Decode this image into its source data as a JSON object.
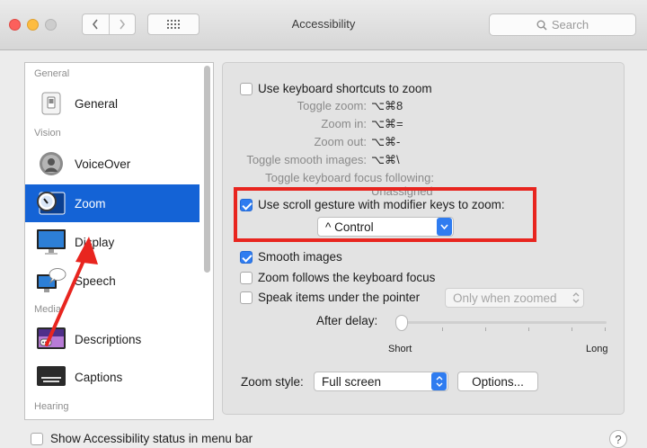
{
  "window": {
    "title": "Accessibility",
    "search_placeholder": "Search"
  },
  "sidebar": {
    "sections": [
      "General",
      "Vision",
      "Media",
      "Hearing"
    ],
    "items": [
      {
        "label": "General",
        "icon": "general-switch-icon"
      },
      {
        "label": "VoiceOver",
        "icon": "voiceover-icon"
      },
      {
        "label": "Zoom",
        "icon": "zoom-icon",
        "selected": true
      },
      {
        "label": "Display",
        "icon": "display-monitor-icon"
      },
      {
        "label": "Speech",
        "icon": "speech-bubble-icon"
      },
      {
        "label": "Descriptions",
        "icon": "descriptions-icon"
      },
      {
        "label": "Captions",
        "icon": "captions-icon"
      }
    ]
  },
  "zoom": {
    "keyboard_shortcuts_label": "Use keyboard shortcuts to zoom",
    "keyboard_shortcuts_checked": false,
    "shortcuts": [
      {
        "label": "Toggle zoom:",
        "value": "⌥⌘8"
      },
      {
        "label": "Zoom in:",
        "value": "⌥⌘="
      },
      {
        "label": "Zoom out:",
        "value": "⌥⌘-"
      },
      {
        "label": "Toggle smooth images:",
        "value": "⌥⌘\\"
      },
      {
        "label": "Toggle keyboard focus following:",
        "value": "Unassigned"
      }
    ],
    "scroll_gesture_label": "Use scroll gesture with modifier keys to zoom:",
    "scroll_gesture_checked": true,
    "modifier_key": "^ Control",
    "smooth_images_label": "Smooth images",
    "smooth_images_checked": true,
    "follow_focus_label": "Zoom follows the keyboard focus",
    "follow_focus_checked": false,
    "speak_items_label": "Speak items under the pointer",
    "speak_items_checked": false,
    "speak_items_option": "Only when zoomed",
    "after_delay_label": "After delay:",
    "delay_short": "Short",
    "delay_long": "Long",
    "delay_value": 0.0,
    "zoom_style_label": "Zoom style:",
    "zoom_style_value": "Full screen",
    "options_button": "Options..."
  },
  "footer": {
    "status_menu_label": "Show Accessibility status in menu bar",
    "status_menu_checked": false,
    "help": "?"
  },
  "colors": {
    "selection_blue": "#1463d6",
    "checkbox_blue": "#2f7cf0",
    "annotation_red": "#e8251f"
  }
}
